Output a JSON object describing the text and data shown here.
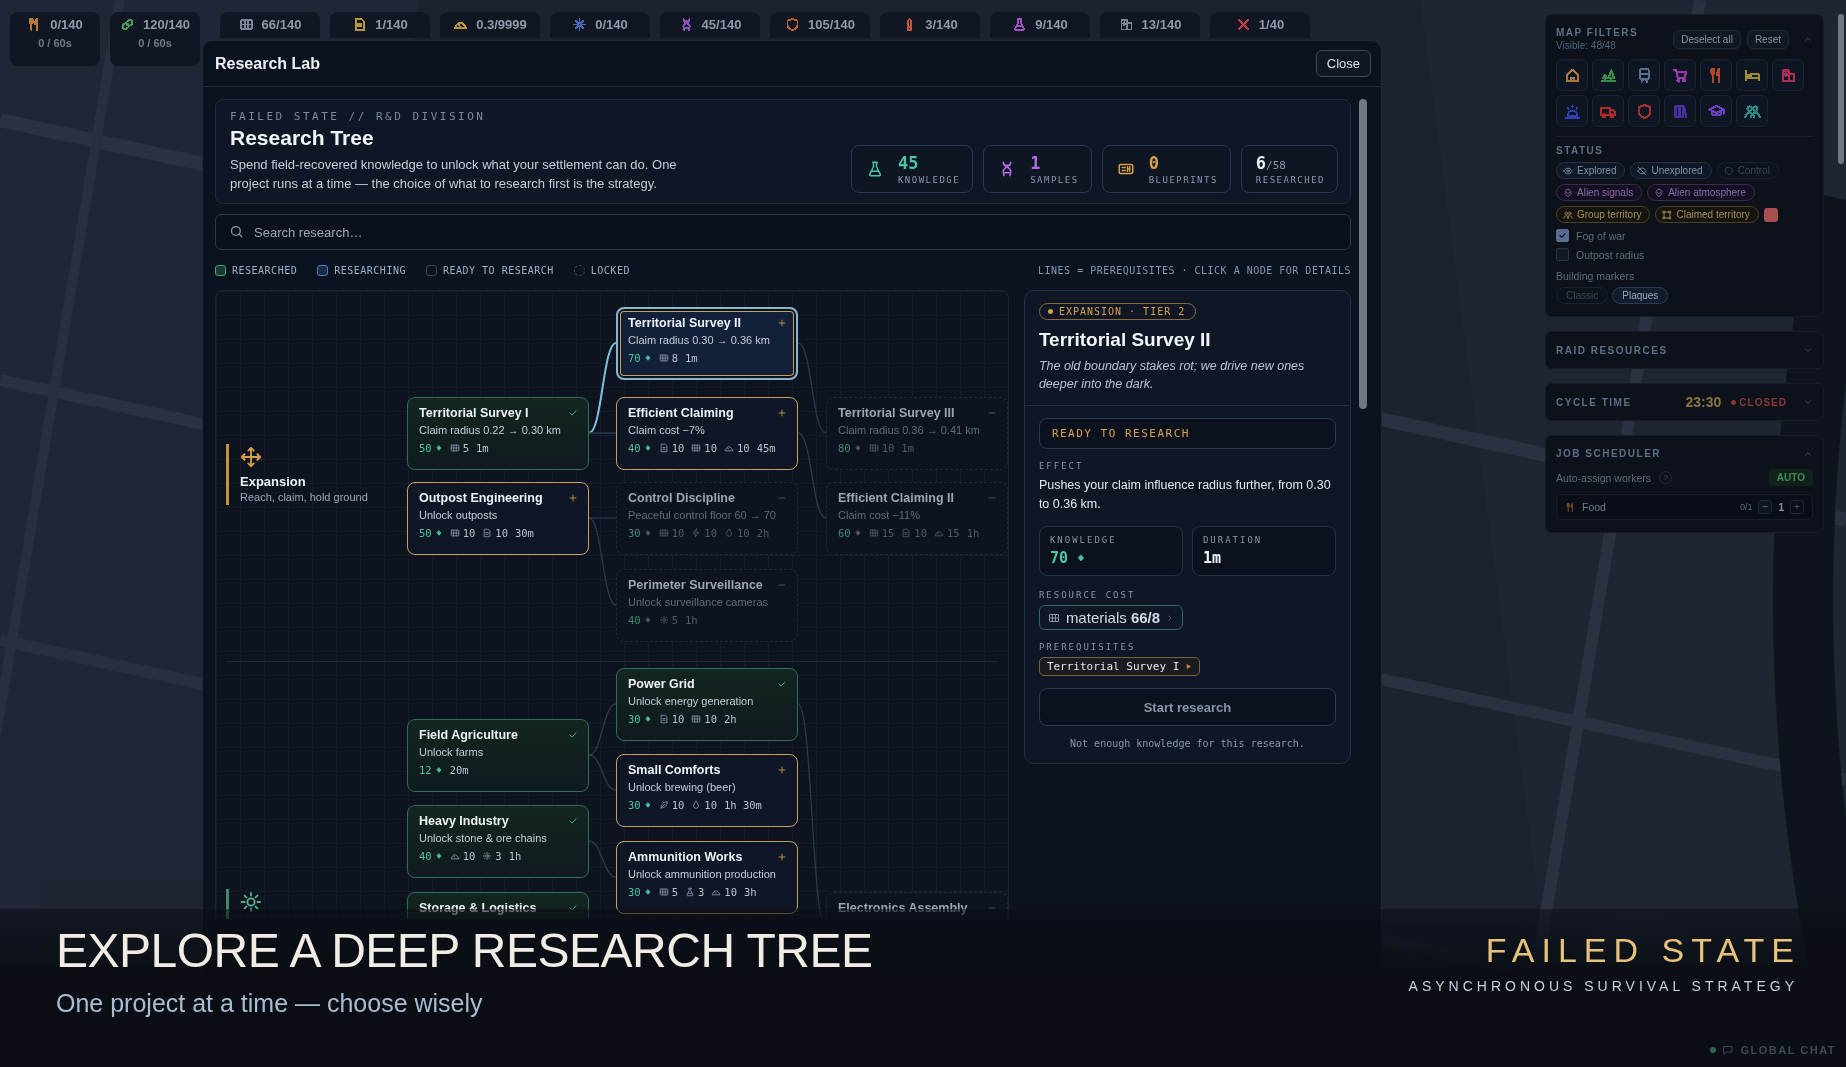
{
  "resource_bar": [
    {
      "kind": "food",
      "color": "#b8783a",
      "amount": "0/140",
      "rate": "0 / 60s"
    },
    {
      "kind": "medicine",
      "color": "#4a9a62",
      "amount": "120/140",
      "rate": "0 / 60s"
    },
    {
      "kind": "materials",
      "color": "#7a8698",
      "amount": "66/140"
    },
    {
      "kind": "blueprints",
      "color": "#b8963a",
      "amount": "1/140"
    },
    {
      "kind": "ore",
      "color": "#b8963a",
      "amount": "0.3/9999"
    },
    {
      "kind": "parts",
      "color": "#4a6ab8",
      "amount": "0/140"
    },
    {
      "kind": "samples",
      "color": "#8a52b8",
      "amount": "45/140"
    },
    {
      "kind": "defense",
      "color": "#b8603a",
      "amount": "105/140"
    },
    {
      "kind": "ammo",
      "color": "#c0583a",
      "amount": "3/140"
    },
    {
      "kind": "chemicals",
      "color": "#a052c0",
      "amount": "9/140"
    },
    {
      "kind": "structures",
      "color": "#7a8698",
      "amount": "13/140"
    },
    {
      "kind": "weapons",
      "color": "#c03a4a",
      "amount": "1/40"
    }
  ],
  "modal": {
    "title": "Research Lab",
    "close": "Close"
  },
  "hero": {
    "eyebrow": "FAILED STATE // R&D DIVISION",
    "title": "Research **Tree**",
    "description": "Spend field-recovered knowledge to unlock what your settlement can do. One project runs at a time — the choice of what to research first is the strategy.",
    "stats": [
      {
        "kind": "knowledge",
        "value": "45",
        "label": "KNOWLEDGE"
      },
      {
        "kind": "samples",
        "value": "1",
        "label": "SAMPLES"
      },
      {
        "kind": "blueprints",
        "value": "0",
        "label": "BLUEPRINTS"
      },
      {
        "kind": "researched",
        "value": "6",
        "total": "/58",
        "label": "RESEARCHED"
      }
    ]
  },
  "search": {
    "placeholder": "Search research…"
  },
  "legend": {
    "items": [
      {
        "kind": "researched",
        "label": "RESEARCHED"
      },
      {
        "kind": "researching",
        "label": "RESEARCHING"
      },
      {
        "kind": "ready",
        "label": "READY TO RESEARCH"
      },
      {
        "kind": "locked",
        "label": "LOCKED"
      }
    ],
    "hint": "LINES = PREREQUISITES · CLICK A NODE FOR DETAILS"
  },
  "tree": {
    "categories": [
      {
        "kind": "expansion",
        "name": "Expansion",
        "tagline": "Reach, claim, hold ground"
      },
      {
        "kind": "economy"
      }
    ],
    "nodes": [
      {
        "title": "Territorial Survey I",
        "kind": "researched",
        "selected": false,
        "description": "Claim radius 0.22 → 0.30 km",
        "knowledge": "50",
        "costs": [
          {
            "kind": "materials",
            "amount": "5"
          }
        ],
        "time": "1m"
      },
      {
        "title": "Outpost Engineering",
        "kind": "ready",
        "selected": false,
        "description": "Unlock outposts",
        "knowledge": "50",
        "costs": [
          {
            "kind": "materials",
            "amount": "10"
          },
          {
            "kind": "blueprints",
            "amount": "10"
          }
        ],
        "time": "30m"
      },
      {
        "title": "Territorial Survey II",
        "kind": "ready",
        "selected": true,
        "description": "Claim radius 0.30 → 0.36 km",
        "knowledge": "70",
        "costs": [
          {
            "kind": "materials",
            "amount": "8"
          }
        ],
        "time": "1m"
      },
      {
        "title": "Efficient Claiming",
        "kind": "ready",
        "selected": false,
        "description": "Claim cost −7%",
        "knowledge": "40",
        "costs": [
          {
            "kind": "blueprints",
            "amount": "10"
          },
          {
            "kind": "materials",
            "amount": "10"
          },
          {
            "kind": "ore",
            "amount": "10"
          }
        ],
        "time": "45m"
      },
      {
        "title": "Control Discipline",
        "kind": "locked",
        "selected": false,
        "description": "Peaceful control floor 60 → 70",
        "knowledge": "30",
        "costs": [
          {
            "kind": "materials",
            "amount": "10"
          },
          {
            "kind": "energy",
            "amount": "10"
          },
          {
            "kind": "water",
            "amount": "10"
          }
        ],
        "time": "2h"
      },
      {
        "title": "Perimeter Surveillance",
        "kind": "locked",
        "selected": false,
        "description": "Unlock surveillance cameras",
        "knowledge": "40",
        "costs": [
          {
            "kind": "parts",
            "amount": "5"
          }
        ],
        "time": "1h"
      },
      {
        "title": "Territorial Survey III",
        "kind": "locked",
        "selected": false,
        "description": "Claim radius 0.36 → 0.41 km",
        "knowledge": "80",
        "costs": [
          {
            "kind": "materials",
            "amount": "10"
          }
        ],
        "time": "1m"
      },
      {
        "title": "Efficient Claiming II",
        "kind": "locked",
        "selected": false,
        "description": "Claim cost −11%",
        "knowledge": "60",
        "costs": [
          {
            "kind": "materials",
            "amount": "15"
          },
          {
            "kind": "blueprints",
            "amount": "10"
          },
          {
            "kind": "ore",
            "amount": "15"
          }
        ],
        "time": "1h"
      },
      {
        "title": "Power Grid",
        "kind": "researched",
        "selected": false,
        "description": "Unlock energy generation",
        "knowledge": "30",
        "costs": [
          {
            "kind": "blueprints",
            "amount": "10"
          },
          {
            "kind": "materials",
            "amount": "10"
          }
        ],
        "time": "2h"
      },
      {
        "title": "Field Agriculture",
        "kind": "researched",
        "selected": false,
        "description": "Unlock farms",
        "knowledge": "12",
        "time": "20m"
      },
      {
        "title": "Small Comforts",
        "kind": "ready",
        "selected": false,
        "description": "Unlock brewing (beer)",
        "knowledge": "30",
        "costs": [
          {
            "kind": "hops",
            "amount": "10"
          },
          {
            "kind": "water",
            "amount": "10"
          }
        ],
        "time": "1h 30m"
      },
      {
        "title": "Heavy Industry",
        "kind": "researched",
        "selected": false,
        "description": "Unlock stone & ore chains",
        "knowledge": "40",
        "costs": [
          {
            "kind": "ore",
            "amount": "10"
          },
          {
            "kind": "parts",
            "amount": "3"
          }
        ],
        "time": "1h"
      },
      {
        "title": "Ammunition Works",
        "kind": "ready",
        "selected": false,
        "description": "Unlock ammunition production",
        "knowledge": "30",
        "costs": [
          {
            "kind": "materials",
            "amount": "5"
          },
          {
            "kind": "chemicals",
            "amount": "3"
          },
          {
            "kind": "ore",
            "amount": "10"
          }
        ],
        "time": "3h"
      },
      {
        "title": "Storage & Logistics",
        "kind": "researched",
        "selected": false
      },
      {
        "title": "Electronics Assembly",
        "kind": "locked",
        "selected": false
      }
    ]
  },
  "detail": {
    "tag": "EXPANSION · TIER 2",
    "title": "Territorial Survey II",
    "flavor": "The old boundary stakes rot; we drive new ones deeper into the dark.",
    "status": "READY TO RESEARCH",
    "effect_label": "EFFECT",
    "effect": "Pushes your claim influence radius further, from 0.30 to 0.36 km.",
    "stats": [
      {
        "kind": "knowledge",
        "label": "KNOWLEDGE",
        "value": "70"
      },
      {
        "kind": "time",
        "label": "DURATION",
        "value": "1m"
      }
    ],
    "cost_label": "RESOURCE COST",
    "costs": [
      {
        "kind": "materials",
        "text": "materials **66/8**"
      }
    ],
    "prereq_label": "PREREQUISITES",
    "prerequisites": [
      "Territorial Survey I"
    ],
    "action": {
      "label": "Start research",
      "disabled": true
    },
    "note": "Not enough knowledge for this research."
  },
  "map_filters": {
    "title": "MAP FILTERS",
    "visible": "Visible: 48/48",
    "buttons": [
      "Deselect all",
      "Reset"
    ],
    "expanded": true,
    "categories": [
      {
        "kind": "home",
        "color": "#a8783a"
      },
      {
        "kind": "park",
        "color": "#3a8a4a"
      },
      {
        "kind": "transit",
        "color": "#5a708a"
      },
      {
        "kind": "shop",
        "color": "#9a3ab0"
      },
      {
        "kind": "food",
        "color": "#b04a2a"
      },
      {
        "kind": "lodging",
        "color": "#a08a3a"
      },
      {
        "kind": "hospital",
        "color": "#a83050"
      },
      {
        "kind": "police",
        "color": "#3040b0"
      },
      {
        "kind": "fire",
        "color": "#b02a2a"
      },
      {
        "kind": "defense",
        "color": "#a03030"
      },
      {
        "kind": "library",
        "color": "#4a30a0"
      },
      {
        "kind": "school",
        "color": "#6a40c0"
      },
      {
        "kind": "community",
        "color": "#2a8a80"
      }
    ],
    "status_title": "STATUS",
    "status_chips": [
      {
        "kind": "explored",
        "label": "Explored",
        "on": true
      },
      {
        "kind": "unexplored",
        "label": "Unexplored",
        "on": true
      },
      {
        "kind": "control",
        "label": "Control",
        "on": false
      },
      {
        "kind": "alien-signals",
        "label": "Alien signals",
        "on": true
      },
      {
        "kind": "alien-atmosphere",
        "label": "Alien atmosphere",
        "on": true
      },
      {
        "kind": "group-territory",
        "label": "Group territory",
        "on": true
      },
      {
        "kind": "claimed-territory",
        "label": "Claimed territory",
        "on": true
      }
    ],
    "territory_swatch": {
      "color": "#a85050"
    },
    "toggles": [
      {
        "label": "Fog of war",
        "checked": true
      },
      {
        "label": "Outpost radius",
        "checked": false
      }
    ],
    "markers_label": "Building markers",
    "markers": [
      {
        "label": "Classic",
        "selected": false
      },
      {
        "label": "Plaques",
        "selected": true
      }
    ]
  },
  "raid_resources": {
    "title": "RAID RESOURCES",
    "expanded": false
  },
  "cycle_time": {
    "title": "CYCLE TIME",
    "time": "23:30",
    "state": "CLOSED",
    "expanded": false
  },
  "job_scheduler": {
    "title": "JOB SCHEDULER",
    "expanded": true,
    "auto_label": "Auto-assign workers",
    "help": "?",
    "auto": "AUTO",
    "rows": [
      {
        "kind": "food",
        "name": "Food",
        "assigned": "0/1",
        "minus": "−",
        "count": "1",
        "plus": "+"
      }
    ]
  },
  "banner": {
    "headline": "EXPLORE A DEEP RESEARCH TREE",
    "subline": "One project at a time — choose wisely",
    "brand": "FAILED STATE",
    "brand_tagline": "ASYNCHRONOUS SURVIVAL STRATEGY"
  },
  "global_chat": {
    "label": "GLOBAL CHAT",
    "online": true
  }
}
